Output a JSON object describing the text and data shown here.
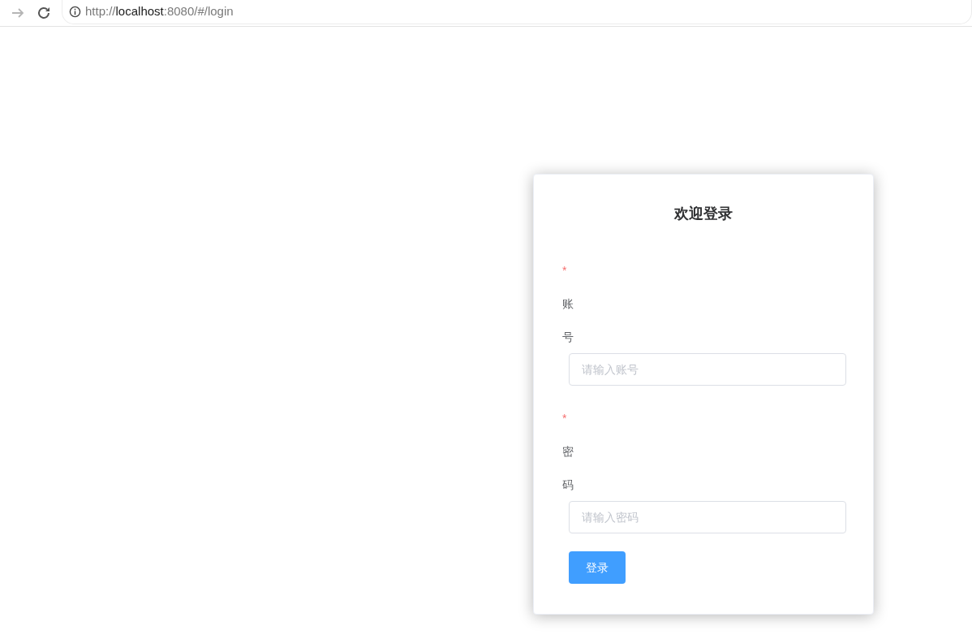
{
  "browser": {
    "forward_disabled": true,
    "url_parts": [
      {
        "text": "http://",
        "strong": false
      },
      {
        "text": "localhost",
        "strong": true
      },
      {
        "text": ":8080/#/login",
        "strong": false
      }
    ]
  },
  "login": {
    "title": "欢迎登录",
    "fields": [
      {
        "required_mark": "*",
        "label": "账号",
        "placeholder": "请输入账号"
      },
      {
        "required_mark": "*",
        "label": "密码",
        "placeholder": "请输入密码"
      }
    ],
    "submit": "登录"
  }
}
